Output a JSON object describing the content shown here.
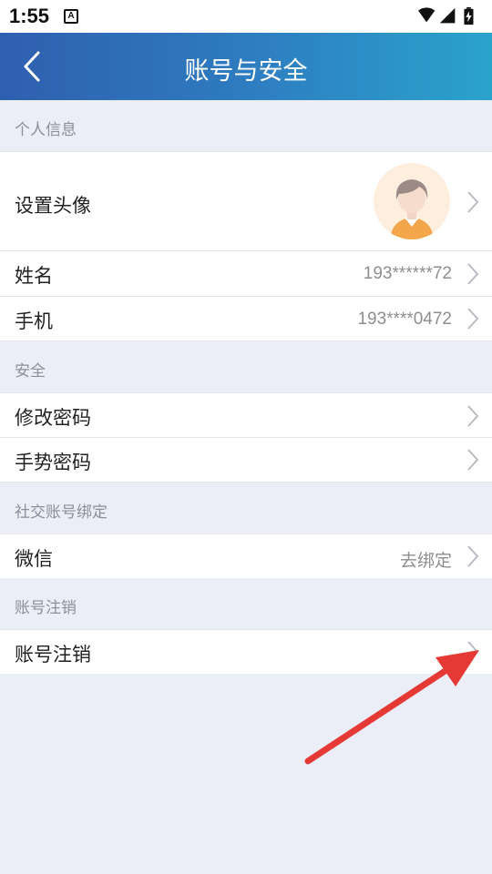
{
  "status": {
    "time": "1:55",
    "notice": "A"
  },
  "header": {
    "title": "账号与安全",
    "back_icon": "chevron-left-icon"
  },
  "sections": {
    "personal": {
      "title": "个人信息",
      "avatar_row": {
        "label": "设置头像"
      },
      "name_row": {
        "label": "姓名",
        "value": "193******72"
      },
      "phone_row": {
        "label": "手机",
        "value": "193****0472"
      }
    },
    "security": {
      "title": "安全",
      "change_password": {
        "label": "修改密码"
      },
      "gesture_password": {
        "label": "手势密码"
      }
    },
    "social": {
      "title": "社交账号绑定",
      "wechat": {
        "label": "微信",
        "value": "去绑定"
      }
    },
    "deregister": {
      "title": "账号注销",
      "row": {
        "label": "账号注销"
      }
    }
  },
  "colors": {
    "header_start": "#2f5fb0",
    "header_end": "#2aa3cc",
    "annotation_arrow": "#e53935"
  }
}
